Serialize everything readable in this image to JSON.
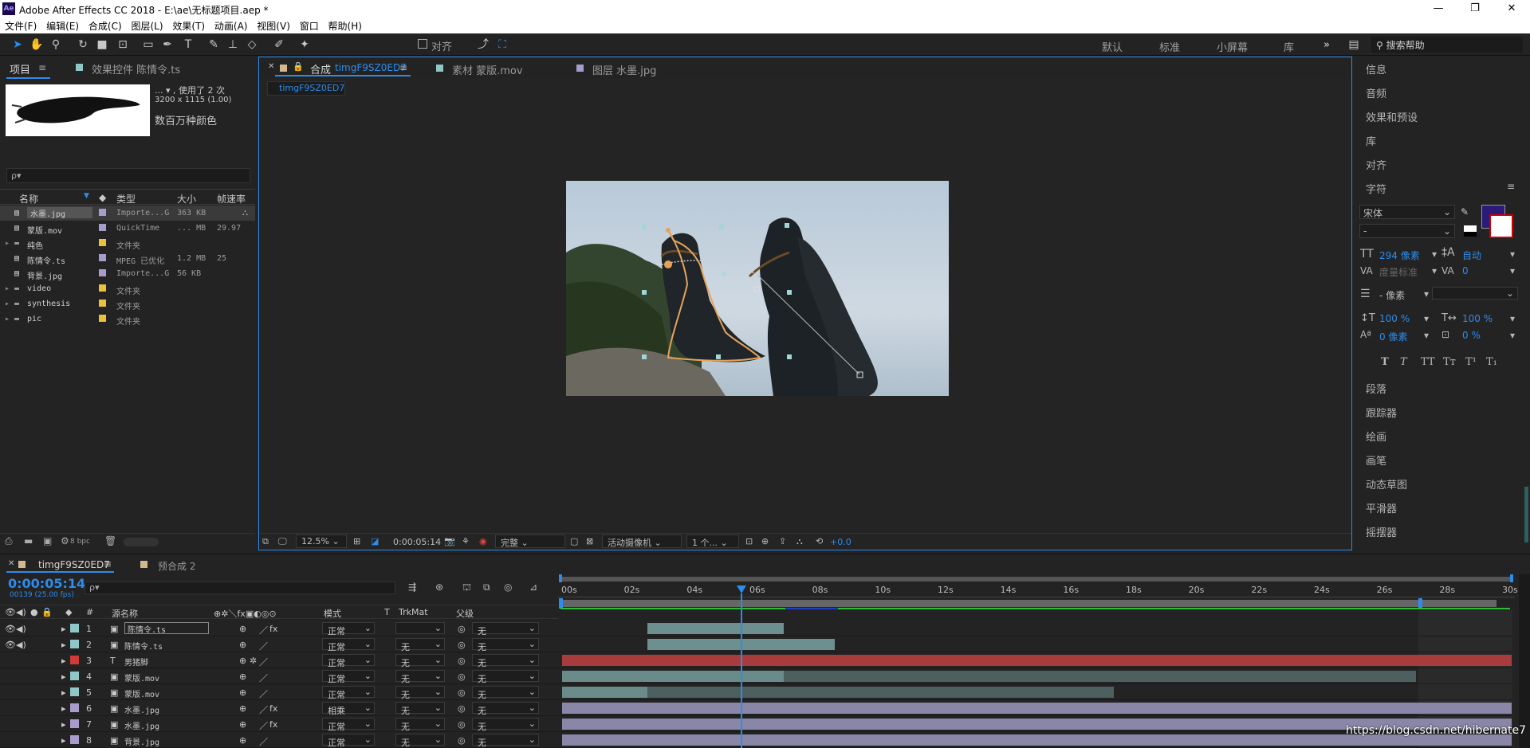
{
  "app": {
    "logo": "Ae",
    "title": "Adobe After Effects CC 2018 - E:\\ae\\无标题项目.aep *"
  },
  "menu": [
    "文件(F)",
    "编辑(E)",
    "合成(C)",
    "图层(L)",
    "效果(T)",
    "动画(A)",
    "视图(V)",
    "窗口",
    "帮助(H)"
  ],
  "toolbar": {
    "align_label": "对齐",
    "workspaces": [
      "默认",
      "标准",
      "小屏幕",
      "库"
    ],
    "more": "»",
    "help_placeholder": "搜索帮助"
  },
  "project": {
    "tab_project": "项目",
    "tab_effects": "效果控件 陈情令.ts",
    "used_info": "...  ▾ , 使用了 2 次",
    "dims_info": "3200 x 1115 (1.00)",
    "color_info": "数百万种颜色",
    "search_placeholder": "ρ▾",
    "columns": [
      "名称",
      "类型",
      "大小",
      "帧速率"
    ],
    "rows": [
      {
        "name": "水墨.jpg",
        "type": "Importe...G",
        "size": "363 KB",
        "fps": "",
        "color": "#a89ccc",
        "folder": false
      },
      {
        "name": "蒙版.mov",
        "type": "QuickTime",
        "size": "... MB",
        "fps": "29.97",
        "color": "#a89ccc",
        "folder": false
      },
      {
        "name": "纯色",
        "type": "文件夹",
        "size": "",
        "fps": "",
        "color": "#e8c23c",
        "folder": true
      },
      {
        "name": "陈情令.ts",
        "type": "MPEG 已优化",
        "size": "1.2 MB",
        "fps": "25",
        "color": "#a89ccc",
        "folder": false
      },
      {
        "name": "背景.jpg",
        "type": "Importe...G",
        "size": "56 KB",
        "fps": "",
        "color": "#a89ccc",
        "folder": false
      },
      {
        "name": "video",
        "type": "文件夹",
        "size": "",
        "fps": "",
        "color": "#e8c23c",
        "folder": true
      },
      {
        "name": "synthesis",
        "type": "文件夹",
        "size": "",
        "fps": "",
        "color": "#e8c23c",
        "folder": true
      },
      {
        "name": "pic",
        "type": "文件夹",
        "size": "",
        "fps": "",
        "color": "#e8c23c",
        "folder": true
      }
    ],
    "bpc": "8 bpc"
  },
  "viewer": {
    "tab_comp": "合成",
    "comp_name": "timgF9SZ0ED7",
    "tab_footage": "素材 蒙版.mov",
    "tab_layer": "图层 水墨.jpg",
    "sub_tab": "timgF9SZ0ED7",
    "zoom": "12.5%",
    "timecode": "0:00:05:14",
    "quality": "完整",
    "camera": "活动摄像机",
    "views": "1 个...",
    "exposure": "+0.0"
  },
  "right_panel": {
    "items_top": [
      "信息",
      "音频",
      "效果和预设",
      "库",
      "对齐",
      "字符"
    ],
    "character": {
      "font": "宋体",
      "style": "-",
      "size": "294 像素",
      "leading": "自动",
      "kerning": "度量标准",
      "tracking": "0",
      "stroke": "- 像素",
      "vscale": "100 %",
      "hscale": "100 %",
      "baseline": "0 像素",
      "tsume": "0 %",
      "styles": [
        "T",
        "T",
        "TT",
        "Tт",
        "T¹",
        "T₁"
      ]
    },
    "items_bottom": [
      "段落",
      "跟踪器",
      "绘画",
      "画笔",
      "动态草图",
      "平滑器",
      "摇摆器"
    ]
  },
  "timeline": {
    "tab_active": "timgF9SZ0ED7",
    "tab_other": "预合成 2",
    "timecode": "0:00:05:14",
    "frame_info": "00139 (25.00 fps)",
    "search_placeholder": "ρ▾",
    "col_source": "源名称",
    "col_mode": "模式",
    "col_t": "T",
    "col_trkmat": "TrkMat",
    "col_parent": "父级",
    "ruler": [
      "00s",
      "02s",
      "04s",
      "06s",
      "08s",
      "10s",
      "12s",
      "14s",
      "16s",
      "18s",
      "20s",
      "22s",
      "24s",
      "26s",
      "28s",
      "30s"
    ],
    "layers": [
      {
        "num": "1",
        "name": "陈情令.ts",
        "mode": "正常",
        "trkmat": "",
        "parent": "无",
        "label": "#8fc6c6",
        "icon": "▣",
        "fx": true,
        "selected": true
      },
      {
        "num": "2",
        "name": "陈情令.ts",
        "mode": "正常",
        "trkmat": "无",
        "parent": "无",
        "label": "#8fc6c6",
        "icon": "▣",
        "fx": false,
        "selected": false
      },
      {
        "num": "3",
        "name": "男猪脚",
        "mode": "正常",
        "trkmat": "无",
        "parent": "无",
        "label": "#d03a3a",
        "icon": "T",
        "fx": false,
        "selected": false
      },
      {
        "num": "4",
        "name": "蒙版.mov",
        "mode": "正常",
        "trkmat": "无",
        "parent": "无",
        "label": "#8fc6c6",
        "icon": "▣",
        "fx": false,
        "selected": false
      },
      {
        "num": "5",
        "name": "蒙版.mov",
        "mode": "正常",
        "trkmat": "无",
        "parent": "无",
        "label": "#8fc6c6",
        "icon": "▣",
        "fx": false,
        "selected": false
      },
      {
        "num": "6",
        "name": "水墨.jpg",
        "mode": "相乘",
        "trkmat": "无",
        "parent": "无",
        "label": "#a89ccc",
        "icon": "▣",
        "fx": true,
        "selected": false
      },
      {
        "num": "7",
        "name": "水墨.jpg",
        "mode": "正常",
        "trkmat": "无",
        "parent": "无",
        "label": "#a89ccc",
        "icon": "▣",
        "fx": true,
        "selected": false
      },
      {
        "num": "8",
        "name": "背景.jpg",
        "mode": "正常",
        "trkmat": "无",
        "parent": "无",
        "label": "#a89ccc",
        "icon": "▣",
        "fx": false,
        "selected": false
      }
    ]
  },
  "watermark": "https://blog.csdn.net/hibernate7"
}
